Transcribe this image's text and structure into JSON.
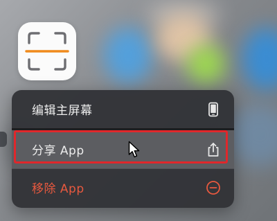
{
  "app": {
    "icon_name": "scanner-icon",
    "accent_color": "#f08a1c"
  },
  "menu": {
    "items": [
      {
        "label": "编辑主屏幕",
        "icon": "phone-icon"
      },
      {
        "label": "分享 App",
        "icon": "share-icon"
      },
      {
        "label": "移除 App",
        "icon": "minus-circle-icon"
      }
    ],
    "danger_color": "#e8593f",
    "highlight_color": "#e0272b"
  }
}
